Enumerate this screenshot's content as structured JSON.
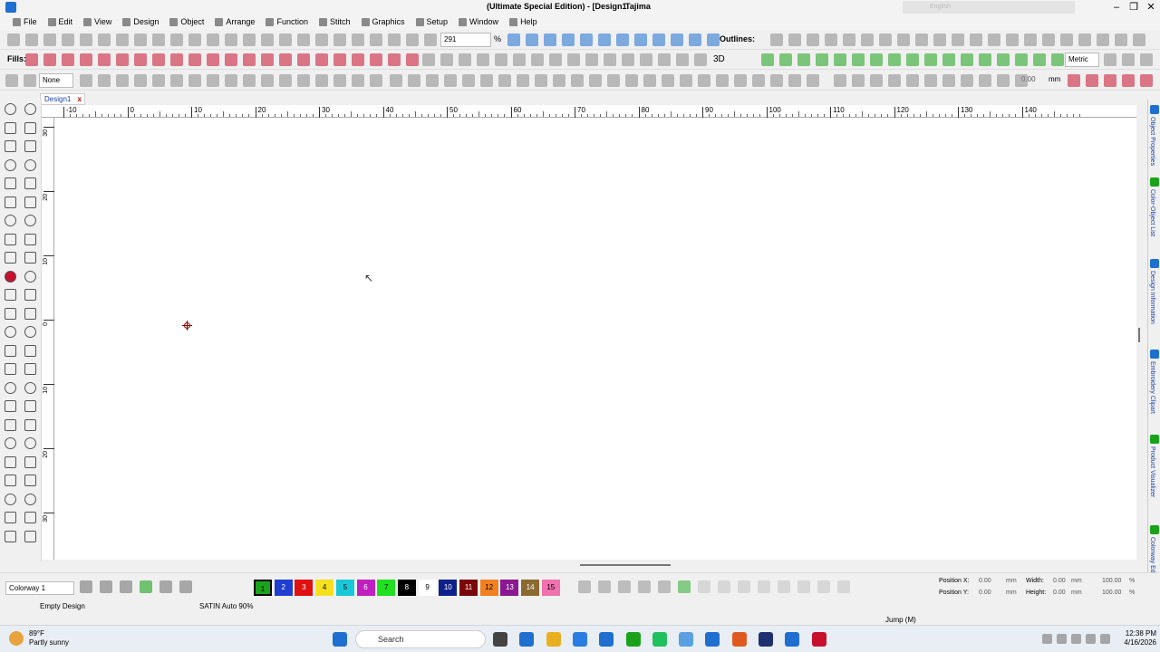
{
  "window": {
    "title": "(Ultimate Special Edition) - [Design1",
    "brand": "Tajima",
    "language": "English",
    "minimize": "–",
    "restore": "❐",
    "close": "✕"
  },
  "menu": [
    "File",
    "Edit",
    "View",
    "Design",
    "Object",
    "Arrange",
    "Function",
    "Stitch",
    "Graphics",
    "Setup",
    "Window",
    "Help"
  ],
  "toolbar": {
    "zoom_value": "291",
    "zoom_unit": "%",
    "outlines_label": "Outlines:",
    "fills_label": "Fills:",
    "threed_label": "3D",
    "metric_value": "Metric",
    "fill_none_value": "None",
    "mm_label": "mm",
    "angle_value": "0.00",
    "colors": {
      "red": "#c8102e",
      "green": "#1aa31a",
      "blue": "#1e6fd0",
      "gray": "#8a8a8a"
    }
  },
  "document": {
    "tab_label": "Design1",
    "tab_close": "x"
  },
  "ruler": {
    "h_ticks": [
      "-10",
      "0",
      "10",
      "20",
      "30",
      "40",
      "50",
      "60",
      "70",
      "80",
      "90",
      "100",
      "110",
      "120",
      "130",
      "140"
    ],
    "v_ticks": [
      "30",
      "20",
      "10",
      "0",
      "10",
      "20",
      "30"
    ]
  },
  "right_panel": [
    "Object Properties",
    "Color-Object List",
    "Design Information",
    "Embroidery Clipart",
    "Product Visualizer",
    "Colorway Editor"
  ],
  "bottom": {
    "colorway_label": "Colorway 1",
    "swatches": [
      {
        "label": "1",
        "color": "#1aa31a",
        "text": "#000"
      },
      {
        "label": "2",
        "color": "#1e3fd0",
        "text": "#fff"
      },
      {
        "label": "3",
        "color": "#e01010",
        "text": "#fff"
      },
      {
        "label": "4",
        "color": "#f5e020",
        "text": "#000"
      },
      {
        "label": "5",
        "color": "#18c8d8",
        "text": "#000"
      },
      {
        "label": "6",
        "color": "#c020c0",
        "text": "#fff"
      },
      {
        "label": "7",
        "color": "#20e020",
        "text": "#000"
      },
      {
        "label": "8",
        "color": "#000000",
        "text": "#fff"
      },
      {
        "label": "9",
        "color": "#ffffff",
        "text": "#000"
      },
      {
        "label": "10",
        "color": "#10208a",
        "text": "#fff"
      },
      {
        "label": "11",
        "color": "#7a0808",
        "text": "#fff"
      },
      {
        "label": "12",
        "color": "#f08020",
        "text": "#000"
      },
      {
        "label": "13",
        "color": "#8a1890",
        "text": "#fff"
      },
      {
        "label": "14",
        "color": "#8a6a30",
        "text": "#fff"
      },
      {
        "label": "15",
        "color": "#f070b0",
        "text": "#000"
      }
    ],
    "position_x_label": "Position X:",
    "position_y_label": "Position Y:",
    "position_x_value": "0.00",
    "position_y_value": "0.00",
    "width_label": "Width:",
    "height_label": "Height:",
    "width_value": "0.00",
    "height_value": "0.00",
    "unit_mm": "mm",
    "pct_w": "100.00",
    "pct_h": "100.00",
    "pct_unit": "%"
  },
  "status": {
    "left": "Empty Design",
    "mid": "SATIN Auto 90%",
    "right": "Jump (M)"
  },
  "taskbar": {
    "temperature": "89°F",
    "weather": "Partly sunny",
    "search_placeholder": "Search",
    "time": "12:38 PM",
    "date": "4/16/2026"
  }
}
